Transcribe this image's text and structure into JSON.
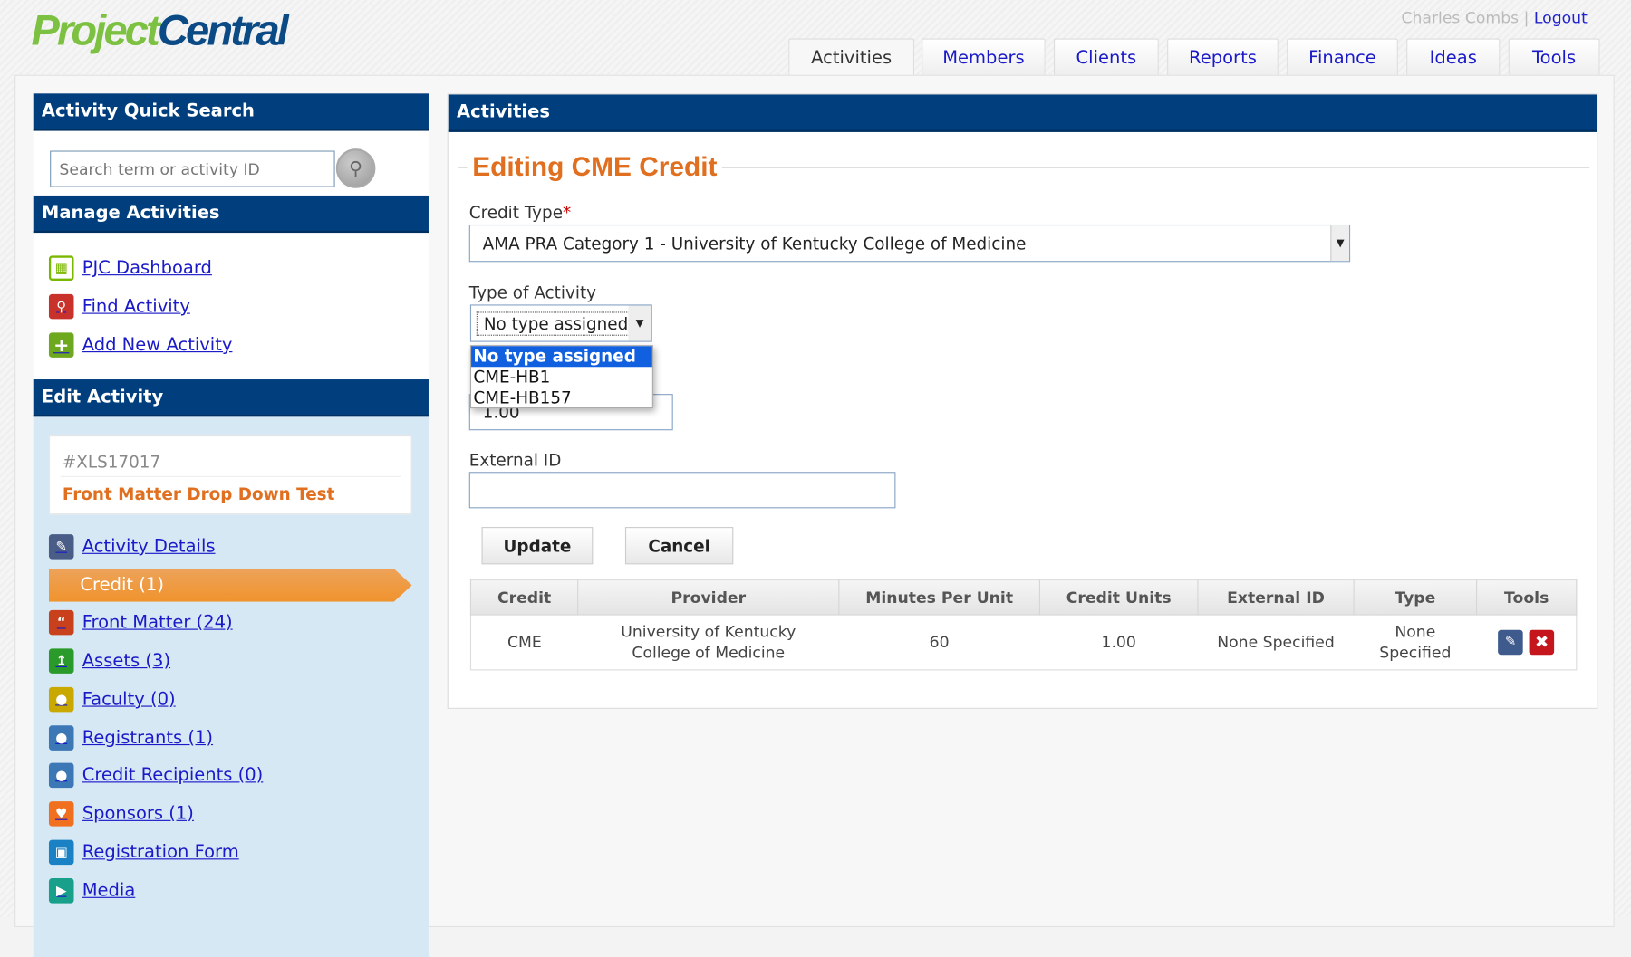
{
  "header": {
    "logo_part1": "Project",
    "logo_part2": "Central",
    "user_name": "Charles Combs",
    "separator": "|",
    "logout": "Logout"
  },
  "tabs": [
    {
      "label": "Activities",
      "active": true
    },
    {
      "label": "Members"
    },
    {
      "label": "Clients"
    },
    {
      "label": "Reports"
    },
    {
      "label": "Finance"
    },
    {
      "label": "Ideas"
    },
    {
      "label": "Tools"
    }
  ],
  "sidebar": {
    "quick_search": {
      "title": "Activity Quick Search",
      "placeholder": "Search term or activity ID"
    },
    "manage": {
      "title": "Manage Activities",
      "items": [
        {
          "label": "PJC Dashboard",
          "icon": "grid-icon"
        },
        {
          "label": "Find Activity",
          "icon": "search-icon"
        },
        {
          "label": "Add New Activity",
          "icon": "plus-icon"
        }
      ]
    },
    "edit": {
      "title": "Edit Activity",
      "activity_id": "#XLS17017",
      "activity_name": "Front Matter Drop Down Test",
      "items": [
        {
          "label": "Activity Details",
          "icon": "pencil-icon"
        },
        {
          "label": "Credit (1)",
          "active": true
        },
        {
          "label": "Front Matter (24)",
          "icon": "quote-icon"
        },
        {
          "label": "Assets (3)",
          "icon": "upload-icon"
        },
        {
          "label": "Faculty (0)",
          "icon": "person-icon"
        },
        {
          "label": "Registrants (1)",
          "icon": "person-icon"
        },
        {
          "label": "Credit Recipients (0)",
          "icon": "person-icon"
        },
        {
          "label": "Sponsors (1)",
          "icon": "heart-icon"
        },
        {
          "label": "Registration Form",
          "icon": "form-icon"
        },
        {
          "label": "Media",
          "icon": "video-icon"
        }
      ]
    }
  },
  "main": {
    "panel_title": "Activities",
    "form_title": "Editing CME Credit",
    "credit_type": {
      "label": "Credit Type",
      "required": "*",
      "value": "AMA PRA Category 1 - University of Kentucky College of Medicine"
    },
    "type_of_activity": {
      "label": "Type of Activity",
      "value": "No type assigned",
      "options": [
        "No type assigned",
        "CME-HB1",
        "CME-HB157"
      ],
      "highlighted": "No type assigned"
    },
    "credit_units_value": "1.00",
    "external_id": {
      "label": "External ID",
      "value": ""
    },
    "update": "Update",
    "cancel": "Cancel",
    "table": {
      "columns": [
        "Credit",
        "Provider",
        "Minutes Per Unit",
        "Credit Units",
        "External ID",
        "Type",
        "Tools"
      ],
      "rows": [
        {
          "credit": "CME",
          "provider": "University of Kentucky College of Medicine",
          "minutes": "60",
          "units": "1.00",
          "external_id": "None Specified",
          "type": "None Specified"
        }
      ]
    }
  },
  "colors": {
    "brand_navy": "#003e7e",
    "accent_orange": "#e07020",
    "link": "#1a1ac8",
    "sidebar_bg": "#d7e8f5"
  }
}
